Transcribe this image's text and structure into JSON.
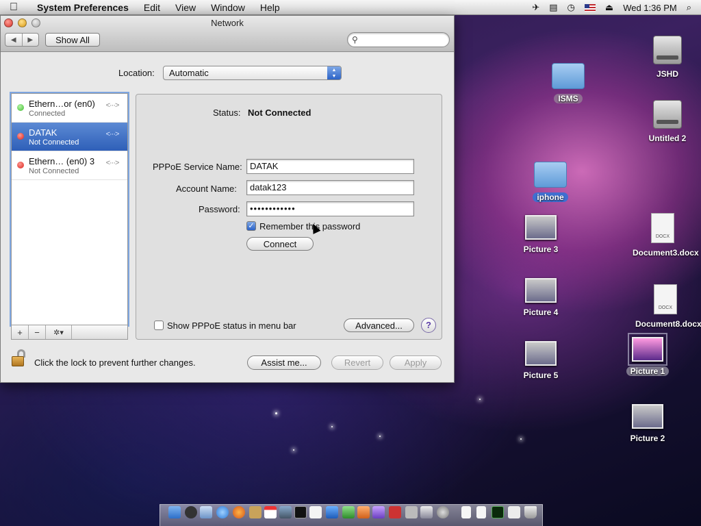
{
  "menubar": {
    "app_name": "System Preferences",
    "items": [
      "Edit",
      "View",
      "Window",
      "Help"
    ],
    "clock": "Wed 1:36 PM"
  },
  "window": {
    "title": "Network",
    "show_all_label": "Show All",
    "search_placeholder": ""
  },
  "location": {
    "label": "Location:",
    "value": "Automatic"
  },
  "services": [
    {
      "name": "Ethern…or (en0)",
      "status": "Connected",
      "status_color": "#3dbb2d"
    },
    {
      "name": "DATAK",
      "status": "Not Connected",
      "status_color": "#d9201a",
      "selected": true
    },
    {
      "name": "Ethern… (en0) 3",
      "status": "Not Connected",
      "status_color": "#d9201a"
    }
  ],
  "list_toolbar": {
    "add": "+",
    "remove": "−",
    "gear": "✲▾"
  },
  "detail": {
    "status_label": "Status:",
    "status_value": "Not Connected",
    "service_name_label": "PPPoE Service Name:",
    "service_name_value": "DATAK",
    "account_label": "Account Name:",
    "account_value": "datak123",
    "password_label": "Password:",
    "password_value": "••••••••••••",
    "remember_label": "Remember this password",
    "remember_checked": true,
    "connect_label": "Connect",
    "show_status_label": "Show PPPoE status in menu bar",
    "show_status_checked": false,
    "advanced_label": "Advanced...",
    "help_label": "?"
  },
  "footer": {
    "lock_text": "Click the lock to prevent further changes.",
    "assist_label": "Assist me...",
    "revert_label": "Revert",
    "apply_label": "Apply"
  },
  "desktop_icons": {
    "jshd": "JSHD",
    "isms": "ISMS",
    "untitled2": "Untitled 2",
    "iphone": "iphone",
    "picture3": "Picture 3",
    "document3": "Document3.docx",
    "picture4": "Picture 4",
    "document8": "Document8.docx",
    "picture5": "Picture 5",
    "picture1": "Picture 1",
    "picture2": "Picture 2",
    "docx_tag": "DOCX"
  },
  "colors": {
    "selection_blue": "#2e5fb8",
    "connected_green": "#3dbb2d",
    "disconnected_red": "#d9201a"
  }
}
